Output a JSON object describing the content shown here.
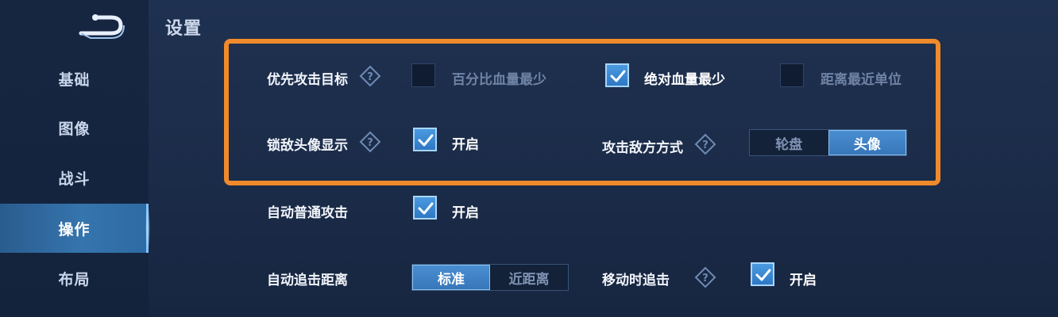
{
  "page_title": "设置",
  "sidebar": {
    "items": [
      {
        "label": "基础",
        "active": false
      },
      {
        "label": "图像",
        "active": false
      },
      {
        "label": "战斗",
        "active": false
      },
      {
        "label": "操作",
        "active": true
      },
      {
        "label": "布局",
        "active": false
      }
    ]
  },
  "settings": {
    "priority_target": {
      "label": "优先攻击目标",
      "options": [
        {
          "label": "百分比血量最少",
          "checked": false
        },
        {
          "label": "绝对血量最少",
          "checked": true
        },
        {
          "label": "距离最近单位",
          "checked": false
        }
      ]
    },
    "lock_avatar": {
      "label": "锁敌头像显示",
      "option_label": "开启",
      "checked": true
    },
    "attack_mode": {
      "label": "攻击敌方方式",
      "options": [
        "轮盘",
        "头像"
      ],
      "selected": 1
    },
    "auto_attack": {
      "label": "自动普通攻击",
      "option_label": "开启",
      "checked": true
    },
    "chase_distance": {
      "label": "自动追击距离",
      "options": [
        "标准",
        "近距离"
      ],
      "selected": 0
    },
    "move_chase": {
      "label": "移动时追击",
      "option_label": "开启",
      "checked": true
    }
  },
  "colors": {
    "highlight_border": "#f08a2b",
    "accent": "#3e86cc",
    "background": "#1c2d4a"
  },
  "icons": {
    "help": "diamond-question-icon",
    "check": "check-icon",
    "back": "back-arrow-icon"
  }
}
